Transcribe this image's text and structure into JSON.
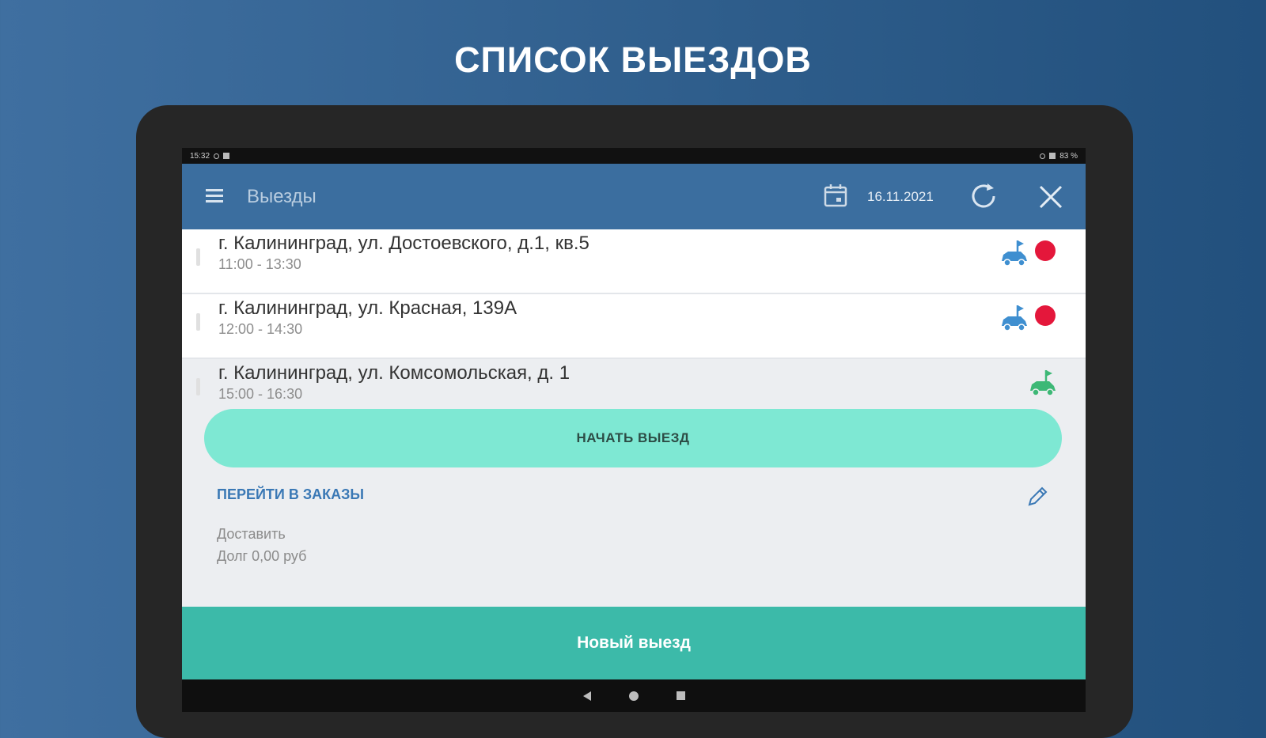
{
  "headline": "СПИСОК ВЫЕЗДОВ",
  "statusbar": {
    "time": "15:32",
    "battery": "83 %"
  },
  "appbar": {
    "menu_icon": "hamburger-icon",
    "title": "Выезды",
    "calendar_icon": "calendar-icon",
    "date": "16.11.2021",
    "refresh_icon": "sync-icon",
    "close_icon": "close-icon"
  },
  "trips": [
    {
      "address": "г. Калининград, ул. Достоевского, д.1, кв.5",
      "time": "11:00 - 13:30",
      "car_icon": "car-flag-icon",
      "car_color": "#3f8fd0",
      "status_color": "#e4173b"
    },
    {
      "address": "г. Калининград, ул. Красная, 139А",
      "time": "12:00 - 14:30",
      "car_icon": "car-flag-icon",
      "car_color": "#3f8fd0",
      "status_color": "#e4173b"
    },
    {
      "address": "г. Калининград, ул. Комсомольская, д. 1",
      "time": "15:00 - 16:30",
      "car_icon": "car-flag-icon",
      "car_color": "#3db876"
    }
  ],
  "actions": {
    "start_label": "НАЧАТЬ ВЫЕЗД",
    "orders_link": "ПЕРЕЙТИ В ЗАКАЗЫ",
    "edit_icon": "pencil-icon",
    "detail_type": "Доставить",
    "detail_debt": "Долг 0,00 руб",
    "new_trip_label": "Новый выезд"
  },
  "colors": {
    "accent": "#3cbaa9",
    "start_button": "#7ee8d3",
    "appbar": "#3b6e9f",
    "link": "#3a78b5"
  }
}
